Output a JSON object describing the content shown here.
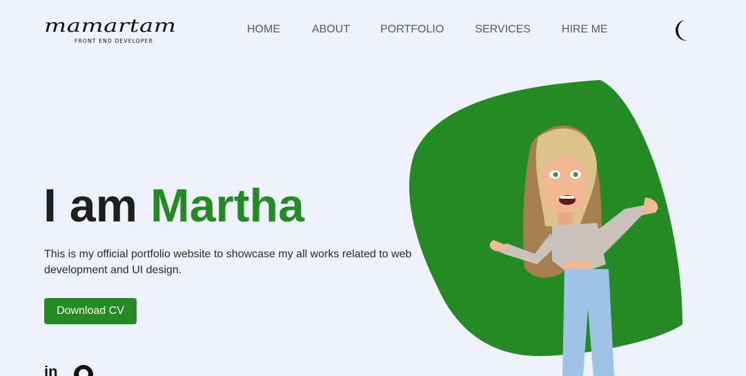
{
  "logo": {
    "script": "mamartam",
    "subtitle": "FRONT END DEVELOPER"
  },
  "nav": {
    "items": [
      "HOME",
      "ABOUT",
      "PORTFOLIO",
      "SERVICES",
      "HIRE ME"
    ]
  },
  "theme_toggle": {
    "icon": "moon-icon"
  },
  "hero": {
    "title_prefix": "I am ",
    "title_name": "Martha",
    "description": "This is my official portfolio website to showcase my all works related to web development and UI design.",
    "cta_label": "Download CV"
  },
  "socials": [
    {
      "icon": "linkedin-icon",
      "glyph": "in"
    },
    {
      "icon": "github-icon"
    }
  ],
  "colors": {
    "accent": "#248a24",
    "background": "#eef2fc",
    "text": "#1f1f1f",
    "nav": "#555a62"
  }
}
